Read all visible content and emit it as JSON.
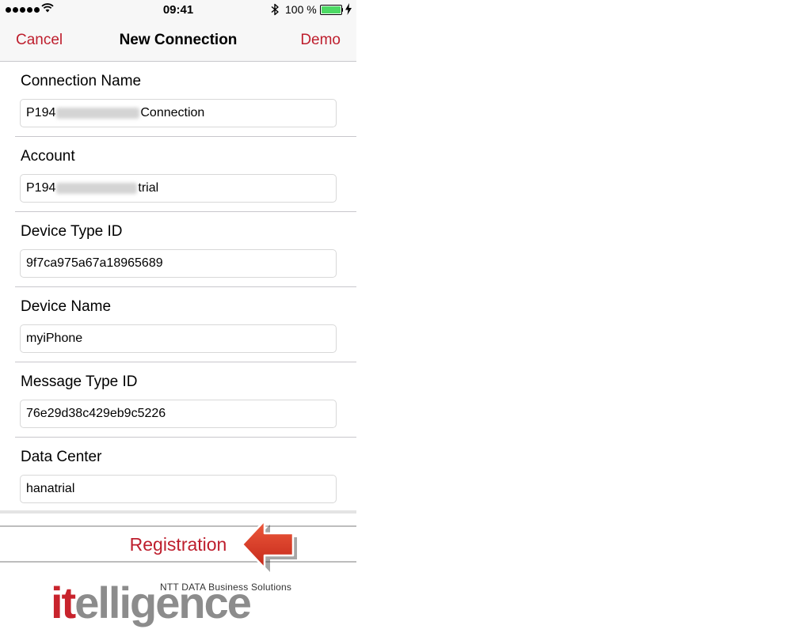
{
  "status_bar": {
    "time": "09:41",
    "battery_percent": "100 %",
    "battery_level": 1.0
  },
  "nav": {
    "cancel_label": "Cancel",
    "title": "New Connection",
    "demo_label": "Demo"
  },
  "form": {
    "fields": [
      {
        "label": "Connection Name",
        "value_prefix": "P194",
        "value_suffix": "Connection"
      },
      {
        "label": "Account",
        "value_prefix": "P194",
        "value_suffix": "trial"
      },
      {
        "label": "Device Type ID",
        "value": "9f7ca975a67a18965689"
      },
      {
        "label": "Device Name",
        "value": "myiPhone"
      },
      {
        "label": "Message Type ID",
        "value": "76e29d38c429eb9c5226"
      },
      {
        "label": "Data Center",
        "value": "hanatrial"
      }
    ]
  },
  "register_button": {
    "label": "Registration"
  },
  "logo": {
    "tagline": "NTT DATA Business Solutions",
    "word_accent": "it",
    "word_rest": "elligence"
  },
  "colors": {
    "accent": "#be1e2d",
    "battery": "#4cd964",
    "arrow": "#d9381e",
    "logo_red": "#c8232c",
    "logo_gray": "#8c8c8c"
  },
  "icons": {
    "signal": "signal-dots-icon",
    "wifi": "wifi-icon",
    "bluetooth": "bluetooth-icon",
    "battery": "battery-icon",
    "charging": "charging-bolt-icon",
    "arrow": "left-arrow-icon"
  }
}
